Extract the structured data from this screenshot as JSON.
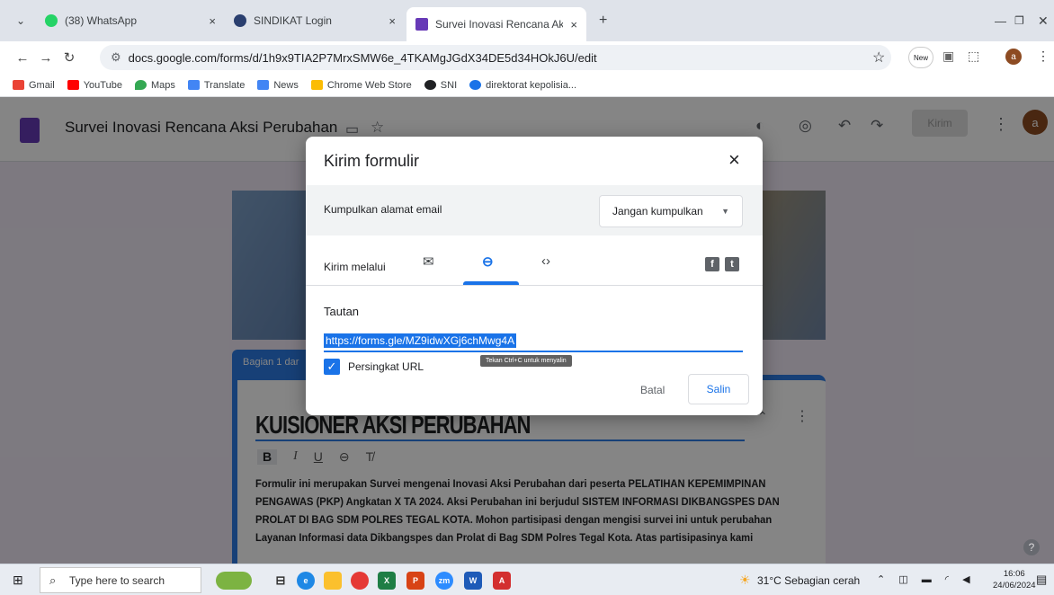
{
  "browser": {
    "tabs": [
      {
        "label": "(38) WhatsApp",
        "color": "#25d366"
      },
      {
        "label": "SINDIKAT Login",
        "color": "#2a3f6f"
      },
      {
        "label": "Survei Inovasi Rencana Aksi Per",
        "color": "#673ab7"
      }
    ],
    "url": "docs.google.com/forms/d/1h9x9TIA2P7MrxSMW6e_4TKAMgJGdX34DE5d34HOkJ6U/edit",
    "bookmarks": [
      "Gmail",
      "YouTube",
      "Maps",
      "Translate",
      "News",
      "Chrome Web Store",
      "SNI",
      "direktorat kepolisia..."
    ]
  },
  "form": {
    "title": "Survei Inovasi Rencana Aksi Perubahan",
    "send_label": "Kirim",
    "avatar_letter": "a",
    "section_tag": "Bagian 1 dar",
    "heading": "KUISIONER AKSI PERUBAHAN",
    "description": "Formulir ini merupakan Survei mengenai Inovasi Aksi Perubahan dari peserta PELATIHAN KEPEMIMPINAN PENGAWAS (PKP) Angkatan X TA 2024. Aksi Perubahan ini berjudul SISTEM INFORMASI DIKBANGSPES DAN PROLAT DI BAG SDM POLRES TEGAL KOTA. Mohon partisipasi dengan mengisi survei ini untuk perubahan Layanan Informasi data Dikbangspes dan Prolat di Bag SDM Polres Tegal Kota. Atas partisipasinya kami"
  },
  "dialog": {
    "title": "Kirim formulir",
    "email_label": "Kumpulkan alamat email",
    "email_option": "Jangan kumpulkan",
    "send_via_label": "Kirim melalui",
    "link_section_label": "Tautan",
    "link_url": "https://forms.gle/MZ9idwXGj6chMwg4A",
    "shorten_label": "Persingkat URL",
    "tooltip": "Tekan Ctrl+C untuk menyalin",
    "cancel_label": "Batal",
    "copy_label": "Salin"
  },
  "taskbar": {
    "search_placeholder": "Type here to search",
    "weather": "31°C  Sebagian cerah",
    "time": "16:06",
    "date": "24/06/2024"
  }
}
